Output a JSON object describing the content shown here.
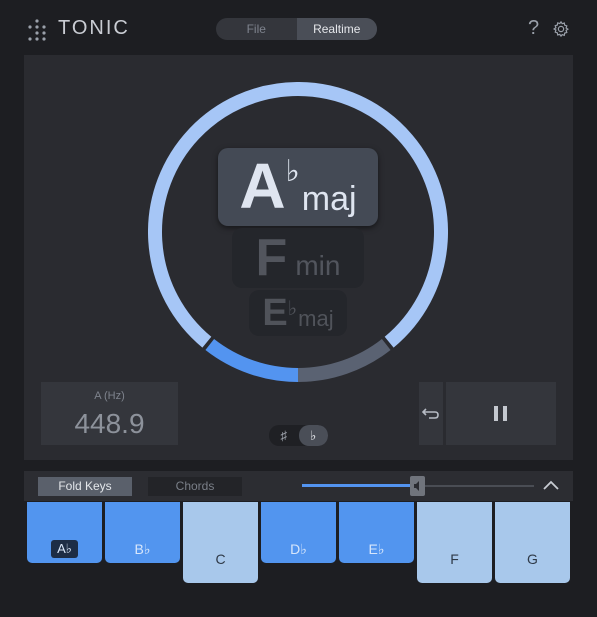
{
  "header": {
    "app_name": "TONIC",
    "tabs": [
      {
        "label": "File",
        "active": false
      },
      {
        "label": "Realtime",
        "active": true
      }
    ],
    "help_label": "?"
  },
  "detector": {
    "confidence": 0.78,
    "colors": {
      "ring": "#a6c6f6",
      "accent": "#5394f0",
      "track": "#5a6272"
    },
    "keys": [
      {
        "letter": "A",
        "accidental": "♭",
        "quality": "maj",
        "rank": 1
      },
      {
        "letter": "F",
        "accidental": "",
        "quality": "min",
        "rank": 2
      },
      {
        "letter": "E",
        "accidental": "♭",
        "quality": "maj",
        "rank": 3
      }
    ]
  },
  "reference": {
    "label": "A (Hz)",
    "value": "448.9"
  },
  "accidentals": {
    "sharp": "♯",
    "flat": "♭",
    "selected": "flat"
  },
  "controls": {
    "undo_icon": "undo-icon",
    "pause_icon": "pause-icon"
  },
  "bottom_bar": {
    "fold_keys_label": "Fold Keys",
    "chords_label": "Chords",
    "volume_level": 0.5
  },
  "keyboard": {
    "keys": [
      {
        "label": "A♭",
        "style": "low",
        "selected": true
      },
      {
        "label": "B♭",
        "style": "low",
        "selected": false
      },
      {
        "label": "C",
        "style": "high",
        "selected": false
      },
      {
        "label": "D♭",
        "style": "low",
        "selected": false
      },
      {
        "label": "E♭",
        "style": "low",
        "selected": false
      },
      {
        "label": "F",
        "style": "high",
        "selected": false
      },
      {
        "label": "G",
        "style": "high",
        "selected": false
      }
    ]
  }
}
